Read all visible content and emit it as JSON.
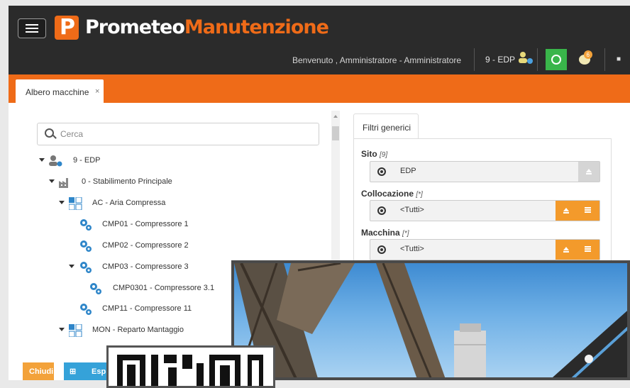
{
  "header": {
    "brand_part1": "Prometeo",
    "brand_part2": "Manutenzione",
    "welcome": "Benvenuto , Amministratore - Amministratore",
    "site": "9 - EDP",
    "notification_count": "6",
    "colors": {
      "bar": "#2b2b2b",
      "accent": "#ef6b18",
      "green": "#39b54a"
    }
  },
  "tabs": [
    {
      "label": "Albero macchine",
      "close": "×"
    }
  ],
  "search": {
    "placeholder": "Cerca"
  },
  "tree": [
    {
      "label": "9 - EDP",
      "icon": "site-icon"
    },
    {
      "label": "0 - Stabilimento Principale",
      "icon": "factory-icon"
    },
    {
      "label": "AC - Aria Compressa",
      "icon": "grid-icon"
    },
    {
      "label": "CMP01 - Compressore 1",
      "icon": "gears-icon"
    },
    {
      "label": "CMP02 - Compressore 2",
      "icon": "gears-icon"
    },
    {
      "label": "CMP03 - Compressore 3",
      "icon": "gears-icon"
    },
    {
      "label": "CMP0301 - Compressore 3.1",
      "icon": "gears-icon"
    },
    {
      "label": "CMP11 - Compressore 11",
      "icon": "gears-icon"
    },
    {
      "label": "MON - Reparto Mantaggio",
      "icon": "grid-icon"
    }
  ],
  "filters": {
    "tab": "Filtri generici",
    "sito": {
      "label": "Sito",
      "hint": "[9]",
      "value": "EDP"
    },
    "collocazione": {
      "label": "Collocazione",
      "hint": "[*]",
      "value": "<Tutti>"
    },
    "macchina": {
      "label": "Macchina",
      "hint": "[*]",
      "value": "<Tutti>"
    }
  },
  "footer": {
    "close": "Chiudi",
    "expand": "Esp"
  }
}
